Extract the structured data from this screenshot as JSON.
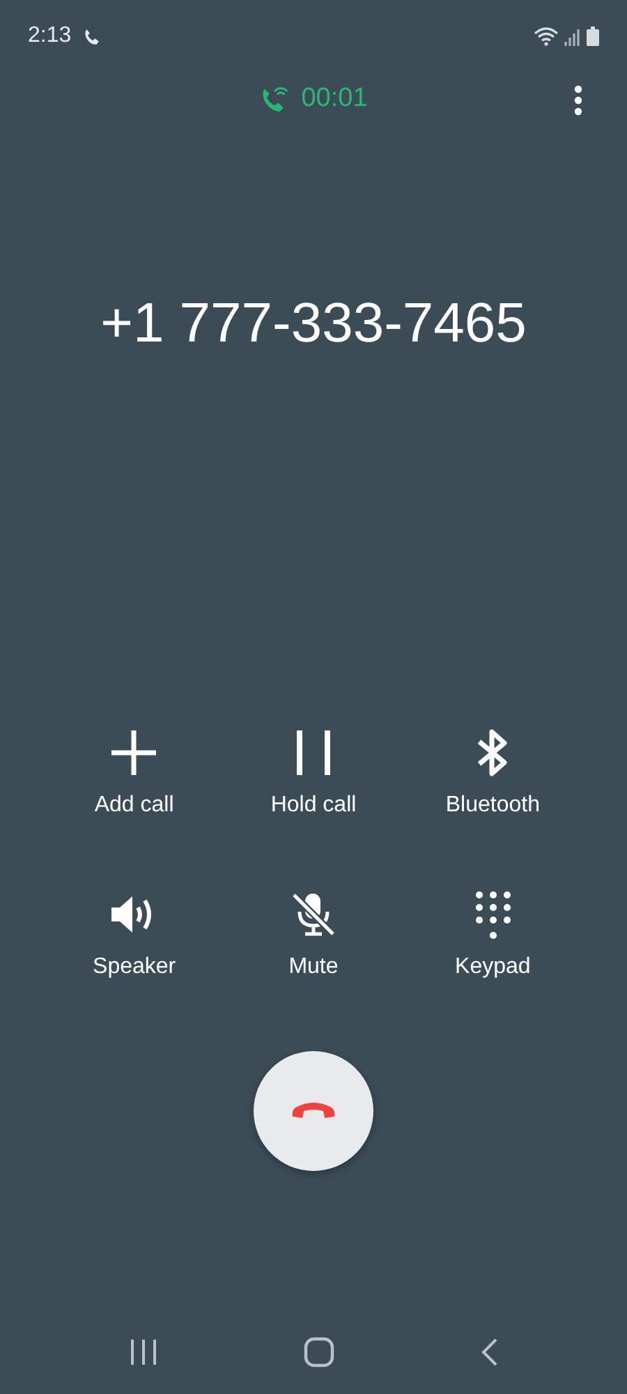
{
  "status_bar": {
    "time": "2:13"
  },
  "call": {
    "duration": "00:01",
    "number": "+1 777-333-7465"
  },
  "actions": [
    {
      "kind": "add",
      "label": "Add call"
    },
    {
      "kind": "hold",
      "label": "Hold call"
    },
    {
      "kind": "bluetooth",
      "label": "Bluetooth"
    },
    {
      "kind": "speaker",
      "label": "Speaker"
    },
    {
      "kind": "mute",
      "label": "Mute"
    },
    {
      "kind": "keypad",
      "label": "Keypad"
    }
  ]
}
